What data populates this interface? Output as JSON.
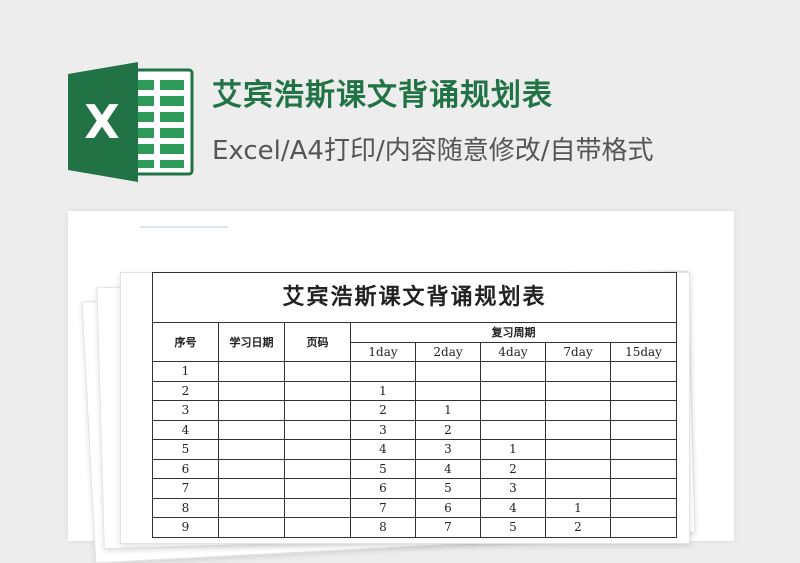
{
  "header": {
    "logo_letter": "X",
    "title": "艾宾浩斯课文背诵规划表",
    "subtitle": "Excel/A4打印/内容随意修改/自带格式"
  },
  "colors": {
    "brand": "#217346",
    "brand_light": "#2e9a5a"
  },
  "sheet": {
    "caption": "艾宾浩斯课文背诵规划表",
    "col_seq": "序号",
    "col_date": "学习日期",
    "col_page": "页码",
    "col_review": "复习周期",
    "days": [
      "1day",
      "2day",
      "4day",
      "7day",
      "15day"
    ],
    "rows": [
      {
        "no": "1",
        "d1": "",
        "d2": "",
        "d4": "",
        "d7": "",
        "d15": ""
      },
      {
        "no": "2",
        "d1": "1",
        "d2": "",
        "d4": "",
        "d7": "",
        "d15": ""
      },
      {
        "no": "3",
        "d1": "2",
        "d2": "1",
        "d4": "",
        "d7": "",
        "d15": ""
      },
      {
        "no": "4",
        "d1": "3",
        "d2": "2",
        "d4": "",
        "d7": "",
        "d15": ""
      },
      {
        "no": "5",
        "d1": "4",
        "d2": "3",
        "d4": "1",
        "d7": "",
        "d15": ""
      },
      {
        "no": "6",
        "d1": "5",
        "d2": "4",
        "d4": "2",
        "d7": "",
        "d15": ""
      },
      {
        "no": "7",
        "d1": "6",
        "d2": "5",
        "d4": "3",
        "d7": "",
        "d15": ""
      },
      {
        "no": "8",
        "d1": "7",
        "d2": "6",
        "d4": "4",
        "d7": "1",
        "d15": ""
      },
      {
        "no": "9",
        "d1": "8",
        "d2": "7",
        "d4": "5",
        "d7": "2",
        "d15": ""
      }
    ]
  }
}
